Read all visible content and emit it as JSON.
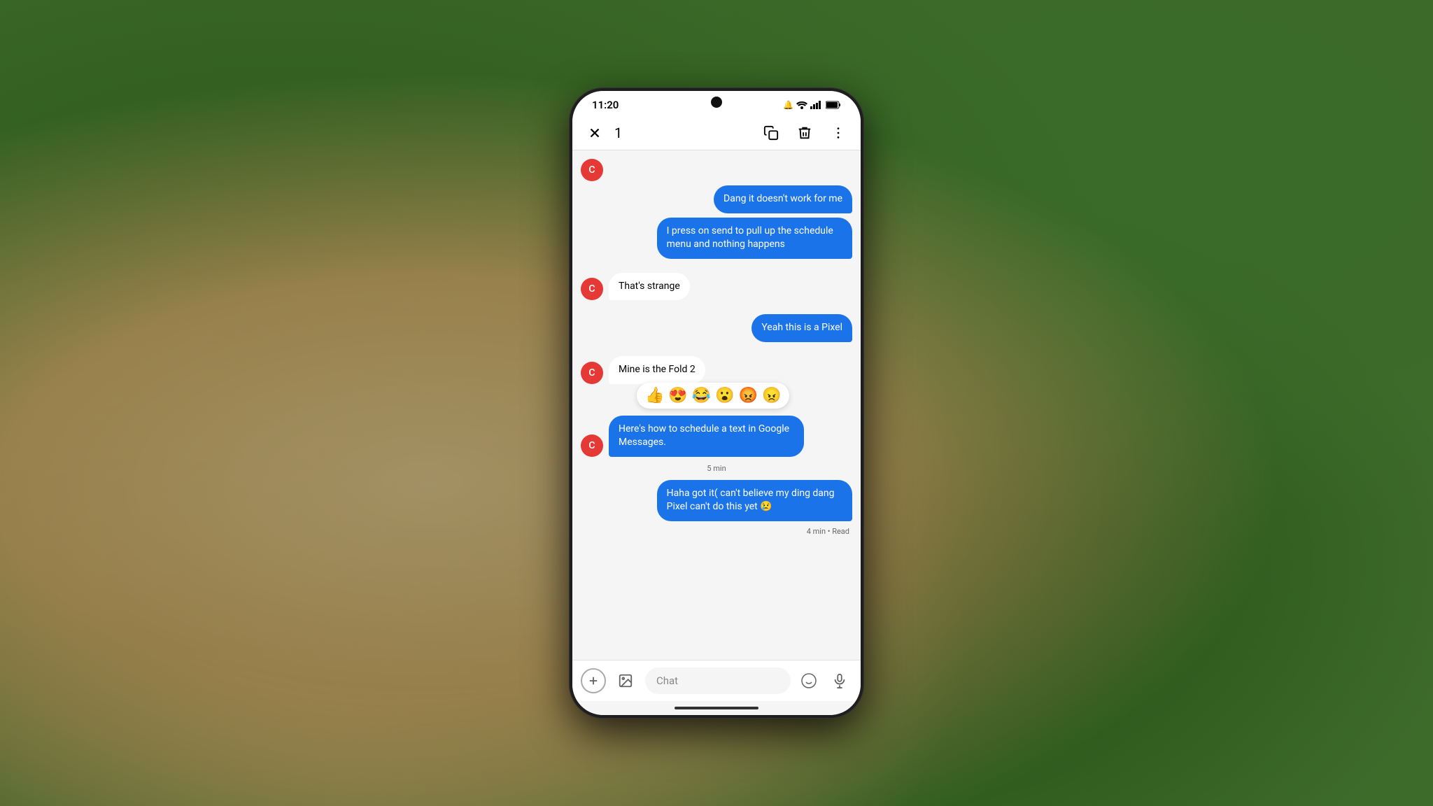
{
  "status_bar": {
    "time": "11:20",
    "icons": [
      "🔔",
      "📶",
      "🔋"
    ]
  },
  "action_bar": {
    "selection_count": "1",
    "close_label": "close",
    "copy_label": "copy",
    "delete_label": "delete",
    "more_label": "more options"
  },
  "contact": {
    "initial": "C"
  },
  "messages": [
    {
      "id": "msg1",
      "type": "outgoing",
      "text": "Dang it doesn't work for me"
    },
    {
      "id": "msg2",
      "type": "outgoing",
      "text": "I press on send to pull up the schedule menu and nothing happens"
    },
    {
      "id": "msg3",
      "type": "incoming",
      "text": "That's strange"
    },
    {
      "id": "msg4",
      "type": "outgoing",
      "text": "Yeah this is a Pixel"
    },
    {
      "id": "msg5",
      "type": "incoming",
      "text": "Mine is the Fold 2"
    },
    {
      "id": "msg6",
      "type": "incoming-blue",
      "text": "Here's how to schedule a text in Google Messages."
    },
    {
      "id": "msg6-time",
      "type": "timestamp",
      "text": "5 min"
    },
    {
      "id": "msg7",
      "type": "outgoing",
      "text": "Haha got it( can't believe my ding dang Pixel can't do this yet 😢"
    },
    {
      "id": "msg7-time",
      "type": "timestamp-right",
      "text": "4 min • Read"
    }
  ],
  "emoji_reactions": [
    "👍",
    "😍",
    "😂",
    "😮",
    "😡",
    "😠"
  ],
  "input_bar": {
    "placeholder": "Chat",
    "add_icon": "+",
    "emoji_icon": "😊",
    "mic_icon": "🎤"
  }
}
